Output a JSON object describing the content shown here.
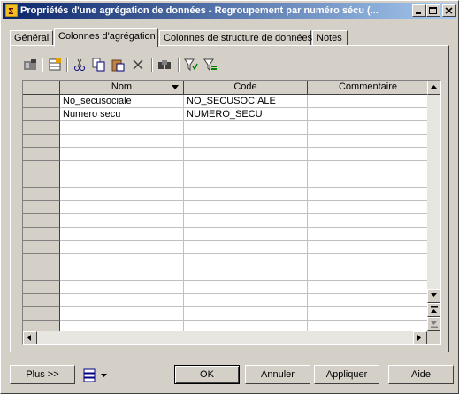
{
  "window": {
    "title": "Propriétés d'une agrégation de données - Regroupement par numéro sécu (...",
    "controls": [
      "minimize-icon",
      "maximize-icon",
      "close-icon"
    ]
  },
  "tabs": [
    {
      "label": "Général",
      "active": false
    },
    {
      "label": "Colonnes d'agrégation",
      "active": true
    },
    {
      "label": "Colonnes de structure de données",
      "active": false
    },
    {
      "label": "Notes",
      "active": false
    }
  ],
  "toolbar": {
    "icons": [
      "properties-icon",
      "add-rows-icon",
      "cut-icon",
      "copy-icon",
      "paste-icon",
      "delete-icon",
      "find-icon",
      "filter-icon",
      "clear-filter-icon"
    ]
  },
  "grid": {
    "columns": [
      "Nom",
      "Code",
      "Commentaire"
    ],
    "rows": [
      [
        "No_secusociale",
        "NO_SECUSOCIALE",
        ""
      ],
      [
        "Numero secu",
        "NUMERO_SECU",
        ""
      ]
    ],
    "empty_rows": 16
  },
  "buttons": {
    "more": "Plus >>",
    "ok": "OK",
    "cancel": "Annuler",
    "apply": "Appliquer",
    "help": "Aide"
  }
}
